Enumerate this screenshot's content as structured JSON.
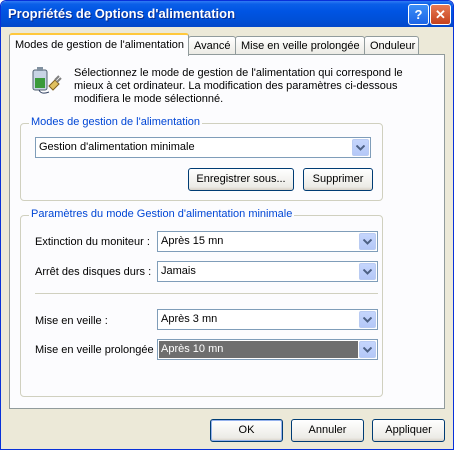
{
  "window": {
    "title": "Propriétés de Options d'alimentation",
    "help_label": "?",
    "close_label": "✕"
  },
  "tabs": [
    "Modes de gestion de l'alimentation",
    "Avancé",
    "Mise en veille prolongée",
    "Onduleur"
  ],
  "description": "Sélectionnez le mode de gestion de l'alimentation qui correspond le mieux à cet ordinateur. La modification des paramètres ci-dessous modifiera le mode sélectionné.",
  "schemes": {
    "group_label": "Modes de gestion de l'alimentation",
    "selected": "Gestion d'alimentation minimale",
    "save_as": "Enregistrer sous...",
    "delete": "Supprimer"
  },
  "settings": {
    "group_label": "Paramètres du mode Gestion d'alimentation minimale",
    "monitor_label": "Extinction du moniteur :",
    "monitor_value": "Après 15 mn",
    "disks_label": "Arrêt des disques durs :",
    "disks_value": "Jamais",
    "standby_label": "Mise en veille :",
    "standby_value": "Après 3 mn",
    "hibernate_label": "Mise en veille prolongée :",
    "hibernate_value": "Après 10 mn"
  },
  "buttons": {
    "ok": "OK",
    "cancel": "Annuler",
    "apply": "Appliquer"
  },
  "colors": {
    "titlebar": "#0054e3",
    "group_label": "#0046d5",
    "selected_highlight": "#6e6e6e"
  }
}
